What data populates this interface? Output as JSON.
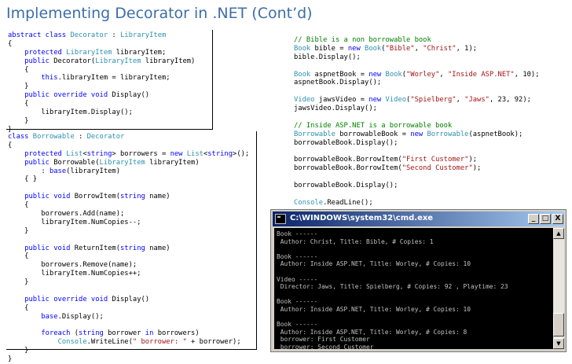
{
  "slide": {
    "title": "Implementing Decorator in .NET (Cont’d)"
  },
  "decorator_code": [
    [
      [
        "kw",
        "abstract class "
      ],
      [
        "ty",
        "Decorator"
      ],
      [
        "tx",
        " : "
      ],
      [
        "ty",
        "LibraryItem"
      ]
    ],
    [
      [
        "tx",
        "{"
      ]
    ],
    [
      [
        "tx",
        "    "
      ],
      [
        "kw",
        "protected "
      ],
      [
        "ty",
        "LibraryItem"
      ],
      [
        "tx",
        " libraryItem;"
      ]
    ],
    [
      [
        "tx",
        "    "
      ],
      [
        "kw",
        "public "
      ],
      [
        "tx",
        "Decorator("
      ],
      [
        "ty",
        "LibraryItem"
      ],
      [
        "tx",
        " libraryItem)"
      ]
    ],
    [
      [
        "tx",
        "    {"
      ]
    ],
    [
      [
        "tx",
        "        "
      ],
      [
        "kw",
        "this"
      ],
      [
        "tx",
        ".libraryItem = libraryItem;"
      ]
    ],
    [
      [
        "tx",
        "    }"
      ]
    ],
    [
      [
        "tx",
        "    "
      ],
      [
        "kw",
        "public override void "
      ],
      [
        "tx",
        "Display()"
      ]
    ],
    [
      [
        "tx",
        "    {"
      ]
    ],
    [
      [
        "tx",
        "        libraryItem.Display();"
      ]
    ],
    [
      [
        "tx",
        "    }"
      ]
    ],
    [
      [
        "tx",
        "}"
      ]
    ]
  ],
  "borrowable_code": [
    [
      [
        "kw",
        "class "
      ],
      [
        "ty",
        "Borrowable"
      ],
      [
        "tx",
        " : "
      ],
      [
        "ty",
        "Decorator"
      ]
    ],
    [
      [
        "tx",
        "{"
      ]
    ],
    [
      [
        "tx",
        "    "
      ],
      [
        "kw",
        "protected "
      ],
      [
        "ty",
        "List"
      ],
      [
        "tx",
        "<"
      ],
      [
        "kw",
        "string"
      ],
      [
        "tx",
        "> borrowers = "
      ],
      [
        "kw",
        "new "
      ],
      [
        "ty",
        "List"
      ],
      [
        "tx",
        "<"
      ],
      [
        "kw",
        "string"
      ],
      [
        "tx",
        ">();"
      ]
    ],
    [
      [
        "tx",
        "    "
      ],
      [
        "kw",
        "public "
      ],
      [
        "tx",
        "Borrowable("
      ],
      [
        "ty",
        "LibraryItem"
      ],
      [
        "tx",
        " libraryItem)"
      ]
    ],
    [
      [
        "tx",
        "        : "
      ],
      [
        "kw",
        "base"
      ],
      [
        "tx",
        "(libraryItem)"
      ]
    ],
    [
      [
        "tx",
        "    { }"
      ]
    ],
    [
      [
        "tx",
        ""
      ]
    ],
    [
      [
        "tx",
        "    "
      ],
      [
        "kw",
        "public void "
      ],
      [
        "tx",
        "BorrowItem("
      ],
      [
        "kw",
        "string "
      ],
      [
        "tx",
        "name)"
      ]
    ],
    [
      [
        "tx",
        "    {"
      ]
    ],
    [
      [
        "tx",
        "        borrowers.Add(name);"
      ]
    ],
    [
      [
        "tx",
        "        libraryItem.NumCopies--;"
      ]
    ],
    [
      [
        "tx",
        "    }"
      ]
    ],
    [
      [
        "tx",
        ""
      ]
    ],
    [
      [
        "tx",
        "    "
      ],
      [
        "kw",
        "public void "
      ],
      [
        "tx",
        "ReturnItem("
      ],
      [
        "kw",
        "string "
      ],
      [
        "tx",
        "name)"
      ]
    ],
    [
      [
        "tx",
        "    {"
      ]
    ],
    [
      [
        "tx",
        "        borrowers.Remove(name);"
      ]
    ],
    [
      [
        "tx",
        "        libraryItem.NumCopies++;"
      ]
    ],
    [
      [
        "tx",
        "    }"
      ]
    ],
    [
      [
        "tx",
        ""
      ]
    ],
    [
      [
        "tx",
        "    "
      ],
      [
        "kw",
        "public override void "
      ],
      [
        "tx",
        "Display()"
      ]
    ],
    [
      [
        "tx",
        "    {"
      ]
    ],
    [
      [
        "tx",
        "        "
      ],
      [
        "kw",
        "base"
      ],
      [
        "tx",
        ".Display();"
      ]
    ],
    [
      [
        "tx",
        ""
      ]
    ],
    [
      [
        "tx",
        "        "
      ],
      [
        "kw",
        "foreach "
      ],
      [
        "tx",
        "("
      ],
      [
        "kw",
        "string "
      ],
      [
        "tx",
        "borrower "
      ],
      [
        "kw",
        "in "
      ],
      [
        "tx",
        "borrowers)"
      ]
    ],
    [
      [
        "tx",
        "            "
      ],
      [
        "ty",
        "Console"
      ],
      [
        "tx",
        ".WriteLine("
      ],
      [
        "st",
        "\" borrower: \""
      ],
      [
        "tx",
        " + borrower);"
      ]
    ],
    [
      [
        "tx",
        "    }"
      ]
    ],
    [
      [
        "tx",
        "}"
      ]
    ]
  ],
  "main_code": [
    [
      [
        "cm",
        "// Bible is a non borrowable book"
      ]
    ],
    [
      [
        "ty",
        "Book"
      ],
      [
        "tx",
        " bible = "
      ],
      [
        "kw",
        "new "
      ],
      [
        "ty",
        "Book"
      ],
      [
        "tx",
        "("
      ],
      [
        "st",
        "\"Bible\""
      ],
      [
        "tx",
        ", "
      ],
      [
        "st",
        "\"Christ\""
      ],
      [
        "tx",
        ", 1);"
      ]
    ],
    [
      [
        "tx",
        "bible.Display();"
      ]
    ],
    [
      [
        "tx",
        ""
      ]
    ],
    [
      [
        "ty",
        "Book"
      ],
      [
        "tx",
        " aspnetBook = "
      ],
      [
        "kw",
        "new "
      ],
      [
        "ty",
        "Book"
      ],
      [
        "tx",
        "("
      ],
      [
        "st",
        "\"Worley\""
      ],
      [
        "tx",
        ", "
      ],
      [
        "st",
        "\"Inside ASP.NET\""
      ],
      [
        "tx",
        ", 10);"
      ]
    ],
    [
      [
        "tx",
        "aspnetBook.Display();"
      ]
    ],
    [
      [
        "tx",
        ""
      ]
    ],
    [
      [
        "ty",
        "Video"
      ],
      [
        "tx",
        " jawsVideo = "
      ],
      [
        "kw",
        "new "
      ],
      [
        "ty",
        "Video"
      ],
      [
        "tx",
        "("
      ],
      [
        "st",
        "\"Spielberg\""
      ],
      [
        "tx",
        ", "
      ],
      [
        "st",
        "\"Jaws\""
      ],
      [
        "tx",
        ", 23, 92);"
      ]
    ],
    [
      [
        "tx",
        "jawsVideo.Display();"
      ]
    ],
    [
      [
        "tx",
        ""
      ]
    ],
    [
      [
        "cm",
        "// Inside ASP.NET is a borrowable book"
      ]
    ],
    [
      [
        "ty",
        "Borrowable"
      ],
      [
        "tx",
        " borrowableBook = "
      ],
      [
        "kw",
        "new "
      ],
      [
        "ty",
        "Borrowable"
      ],
      [
        "tx",
        "(aspnetBook);"
      ]
    ],
    [
      [
        "tx",
        "borrowableBook.Display();"
      ]
    ],
    [
      [
        "tx",
        ""
      ]
    ],
    [
      [
        "tx",
        "borrowableBook.BorrowItem("
      ],
      [
        "st",
        "\"First Customer\""
      ],
      [
        "tx",
        ");"
      ]
    ],
    [
      [
        "tx",
        "borrowableBook.BorrowItem("
      ],
      [
        "st",
        "\"Second Customer\""
      ],
      [
        "tx",
        ");"
      ]
    ],
    [
      [
        "tx",
        ""
      ]
    ],
    [
      [
        "tx",
        "borrowableBook.Display();"
      ]
    ],
    [
      [
        "tx",
        ""
      ]
    ],
    [
      [
        "ty",
        "Console"
      ],
      [
        "tx",
        ".ReadLine();"
      ]
    ]
  ],
  "console": {
    "title": "C:\\WINDOWS\\system32\\cmd.exe",
    "minimize_label": "_",
    "maximize_label": "□",
    "close_label": "X",
    "scroll_up_label": "▲",
    "scroll_down_label": "▼",
    "lines": [
      "Book ------",
      " Author: Christ, Title: Bible, # Copies: 1",
      "",
      "Book ------",
      " Author: Inside ASP.NET, Title: Worley, # Copies: 10",
      "",
      "Video -----",
      " Director: Jaws, Title: Spielberg, # Copies: 92 , Playtime: 23",
      "",
      "Book ------",
      " Author: Inside ASP.NET, Title: Worley, # Copies: 10",
      "",
      "Book ------",
      " Author: Inside ASP.NET, Title: Worley, # Copies: 8",
      " borrower: First Customer",
      " borrower: Second Customer"
    ]
  },
  "colors": {
    "title": "#3d6ea8",
    "keyword": "#0000ff",
    "type": "#2b91af",
    "string": "#a31515",
    "comment": "#008000"
  }
}
